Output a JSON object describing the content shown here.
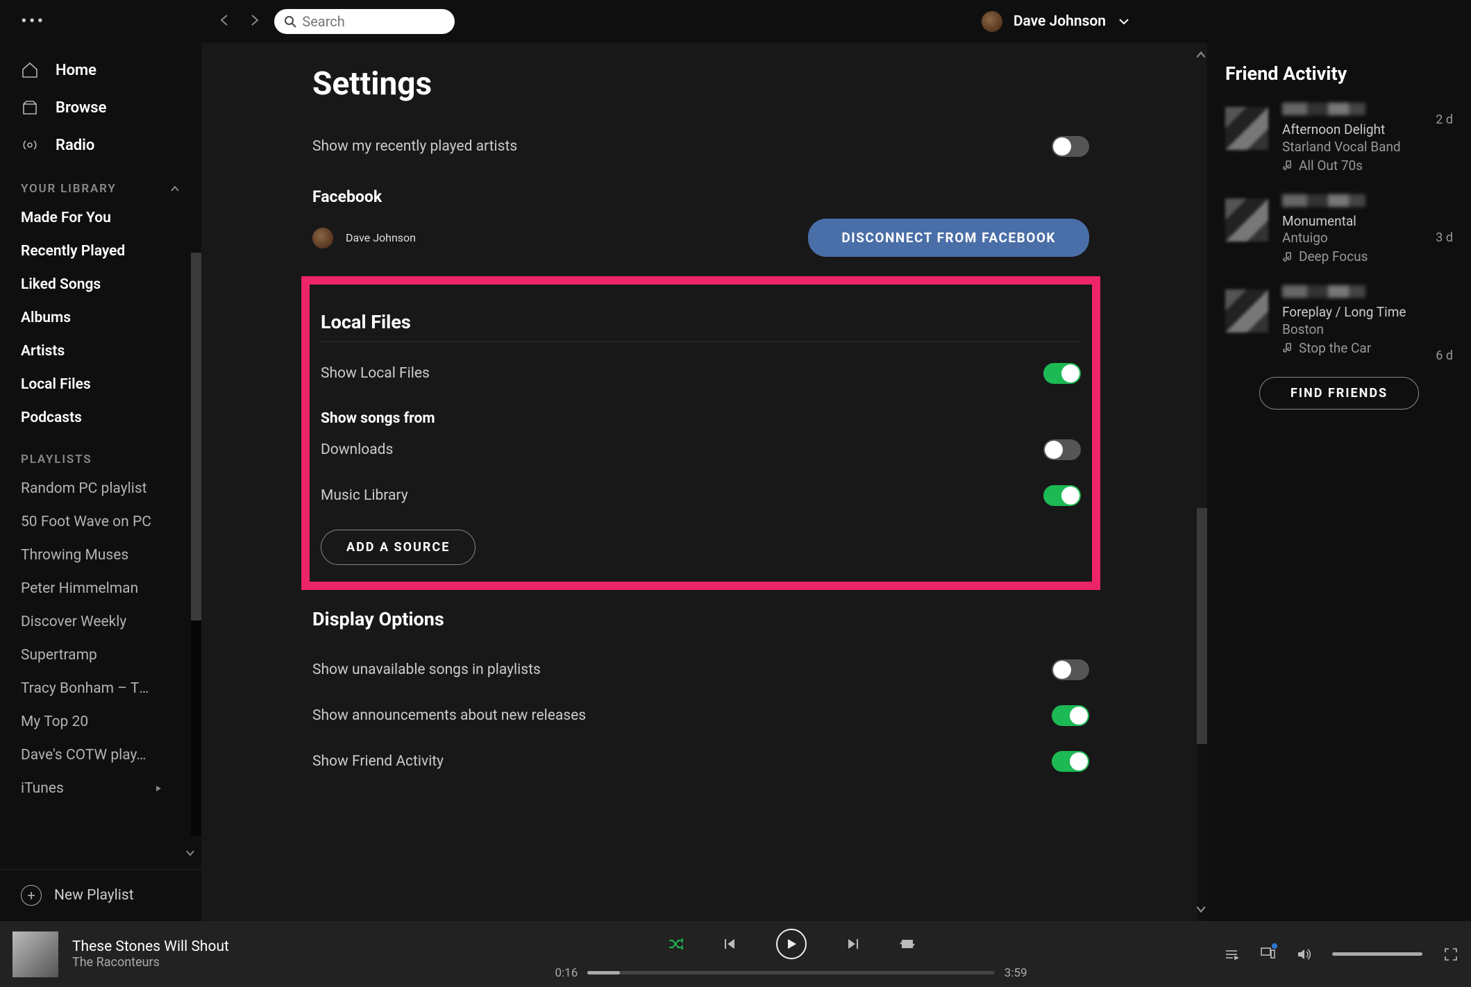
{
  "window": {
    "user_name": "Dave Johnson"
  },
  "search": {
    "placeholder": "Search"
  },
  "nav": {
    "home": "Home",
    "browse": "Browse",
    "radio": "Radio"
  },
  "library": {
    "header": "YOUR LIBRARY",
    "items": [
      "Made For You",
      "Recently Played",
      "Liked Songs",
      "Albums",
      "Artists",
      "Local Files",
      "Podcasts"
    ]
  },
  "playlists": {
    "header": "PLAYLISTS",
    "items": [
      "Random PC playlist",
      "50 Foot Wave on PC",
      "Throwing Muses",
      "Peter Himmelman",
      "Discover Weekly",
      "Supertramp",
      "Tracy Bonham – Th…",
      "My Top 20",
      "Dave's COTW play…",
      "iTunes"
    ]
  },
  "new_playlist": "New Playlist",
  "settings": {
    "title": "Settings",
    "recently_played": "Show my recently played artists",
    "facebook_header": "Facebook",
    "fb_user": "Dave Johnson",
    "fb_disconnect": "DISCONNECT FROM FACEBOOK",
    "local_files": {
      "header": "Local Files",
      "show": "Show Local Files",
      "songs_from": "Show songs from",
      "downloads": "Downloads",
      "music_lib": "Music Library",
      "add_source": "ADD A SOURCE"
    },
    "display": {
      "header": "Display Options",
      "unavailable": "Show unavailable songs in playlists",
      "announcements": "Show announcements about new releases",
      "friend_activity": "Show Friend Activity"
    }
  },
  "friends": {
    "title": "Friend Activity",
    "find": "FIND FRIENDS",
    "items": [
      {
        "track": "Afternoon Delight",
        "artist": "Starland Vocal Band",
        "context": "All Out 70s",
        "time": "2 d"
      },
      {
        "track": "Monumental",
        "artist": "Antuigo",
        "context": "Deep Focus",
        "time": "3 d"
      },
      {
        "track": "Foreplay / Long Time",
        "artist": "Boston",
        "context": "Stop the Car",
        "time": "6 d"
      }
    ]
  },
  "player": {
    "track": "These Stones Will Shout",
    "artist": "The Raconteurs",
    "elapsed": "0:16",
    "total": "3:59"
  },
  "colors": {
    "accent": "#1db954",
    "highlight": "#ed2566",
    "fb": "#4a6ea8"
  }
}
